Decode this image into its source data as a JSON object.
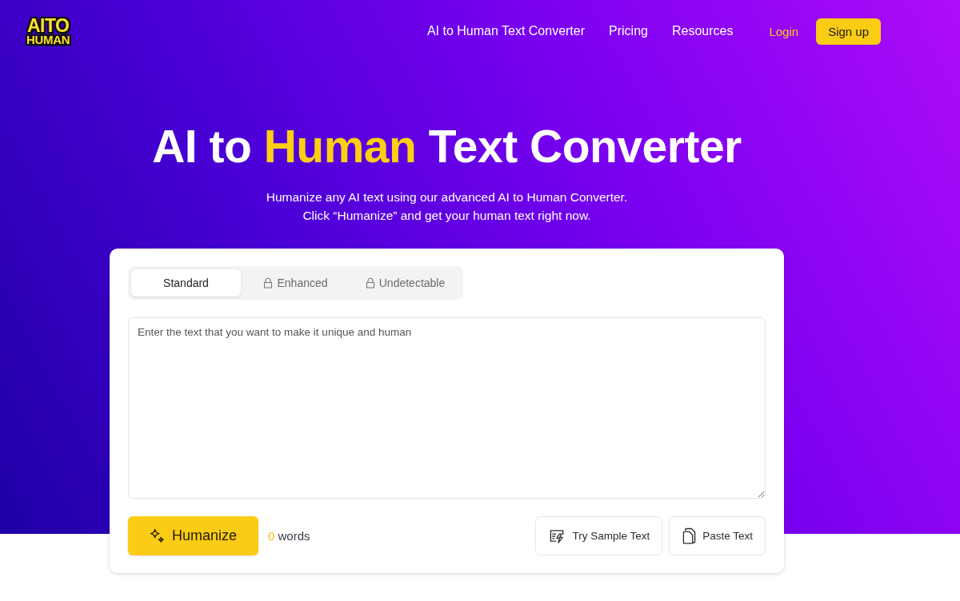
{
  "header": {
    "logo": {
      "lines": [
        "AITO",
        "HUMAN"
      ]
    },
    "nav": [
      "AI to Human Text Converter",
      "Pricing",
      "Resources"
    ],
    "login": "Login",
    "signup": "Sign up"
  },
  "hero": {
    "title": [
      {
        "text": "AI to",
        "highlight": false
      },
      {
        "text": "Human",
        "highlight": true
      },
      {
        "text": "Text Converter",
        "highlight": false
      }
    ],
    "subtitle": [
      "Humanize any AI text using our advanced AI to Human Converter.",
      "Click “Humanize” and get your human text right now."
    ]
  },
  "converter": {
    "tabs": [
      {
        "label": "Standard",
        "selected": true,
        "locked": false
      },
      {
        "label": "Enhanced",
        "selected": false,
        "locked": true
      },
      {
        "label": "Undetectable",
        "selected": false,
        "locked": true
      }
    ],
    "input": {
      "placeholder": "Enter the text that you want to make it unique and human"
    },
    "humanize_button": "Humanize",
    "word_count": {
      "count": "0",
      "unit": "words"
    },
    "actions": [
      {
        "label": "Try Sample Text",
        "kind": "sample"
      },
      {
        "label": "Paste Text",
        "kind": "paste"
      }
    ]
  }
}
